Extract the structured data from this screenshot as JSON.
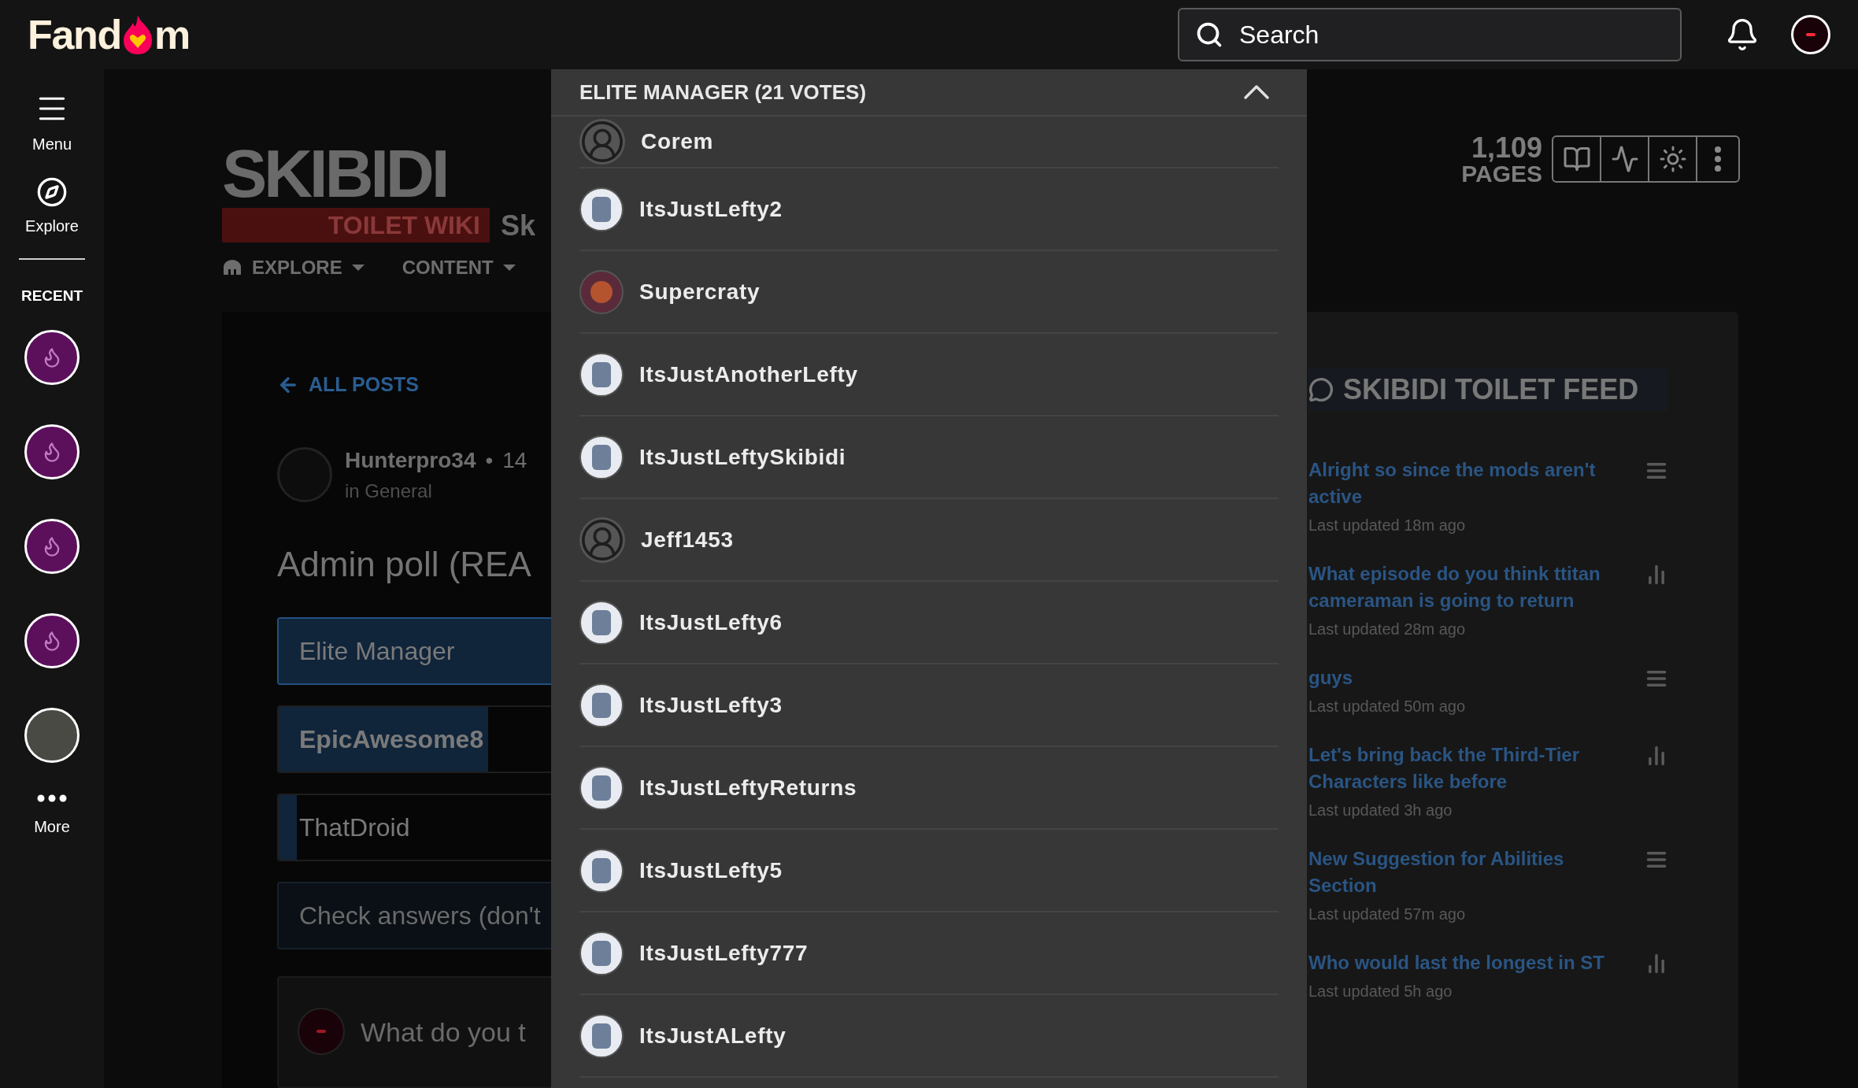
{
  "header": {
    "logo_left": "Fand",
    "logo_right": "m",
    "search": {
      "placeholder": "Search"
    }
  },
  "sidebar": {
    "items": [
      {
        "label": "Menu",
        "kind": "menu"
      },
      {
        "label": "Explore",
        "kind": "explore"
      }
    ],
    "recent_heading": "RECENT",
    "recent": [
      {
        "kind": "community"
      },
      {
        "kind": "community"
      },
      {
        "kind": "community"
      },
      {
        "kind": "community"
      },
      {
        "kind": "photo"
      }
    ],
    "more": "More"
  },
  "wiki": {
    "logo_top": "SKIBIDI",
    "logo_bottom": "TOILET WIKI",
    "title_fragment": "Sk",
    "nav": [
      {
        "label": "EXPLORE",
        "kind": "explore"
      },
      {
        "label": "CONTENT",
        "kind": "plain"
      }
    ],
    "page_count": "1,109",
    "page_label": "PAGES",
    "tools": [
      {
        "kind": "book"
      },
      {
        "kind": "activity"
      },
      {
        "kind": "theme"
      },
      {
        "kind": "more"
      }
    ]
  },
  "post": {
    "back": "ALL POSTS",
    "author": "Hunterpro34",
    "separator": "•",
    "time": "14",
    "forum": "in General",
    "title": "Admin poll (REA",
    "options": [
      {
        "label": "Elite Manager",
        "selected": true,
        "level": 0.7
      },
      {
        "label": "EpicAwesome8",
        "selected": false,
        "level": 0.23
      },
      {
        "label": "ThatDroid",
        "selected": false,
        "level": 0.02
      }
    ],
    "check_button": "Check answers (don't",
    "comment_placeholder": "What do you t"
  },
  "feed": {
    "title": "SKIBIDI TOILET FEED",
    "items": [
      {
        "title": "Alright so since the mods aren't active",
        "updated": "Last updated 18m ago",
        "kind": "text"
      },
      {
        "title": "What episode do you think ttitan cameraman is going to return",
        "updated": "Last updated 28m ago",
        "kind": "poll"
      },
      {
        "title": "guys",
        "updated": "Last updated 50m ago",
        "kind": "text"
      },
      {
        "title": "Let's bring back the Third-Tier Characters like before",
        "updated": "Last updated 3h ago",
        "kind": "poll"
      },
      {
        "title": "New Suggestion for Abilities Section",
        "updated": "Last updated 57m ago",
        "kind": "text"
      },
      {
        "title": "Who would last the longest in ST",
        "updated": "Last updated 5h ago",
        "kind": "poll"
      }
    ]
  },
  "modal": {
    "title": "ELITE MANAGER (21 VOTES)",
    "voters": [
      {
        "name": "Corem",
        "kind": "default"
      },
      {
        "name": "ItsJustLefty2",
        "kind": "picture"
      },
      {
        "name": "Supercraty",
        "kind": "purple"
      },
      {
        "name": "ItsJustAnotherLefty",
        "kind": "picture"
      },
      {
        "name": "ItsJustLeftySkibidi",
        "kind": "picture"
      },
      {
        "name": "Jeff1453",
        "kind": "default"
      },
      {
        "name": "ItsJustLefty6",
        "kind": "picture"
      },
      {
        "name": "ItsJustLefty3",
        "kind": "picture"
      },
      {
        "name": "ItsJustLeftyReturns",
        "kind": "picture"
      },
      {
        "name": "ItsJustLefty5",
        "kind": "picture"
      },
      {
        "name": "ItsJustLefty777",
        "kind": "picture"
      },
      {
        "name": "ItsJustALefty",
        "kind": "picture"
      }
    ]
  }
}
